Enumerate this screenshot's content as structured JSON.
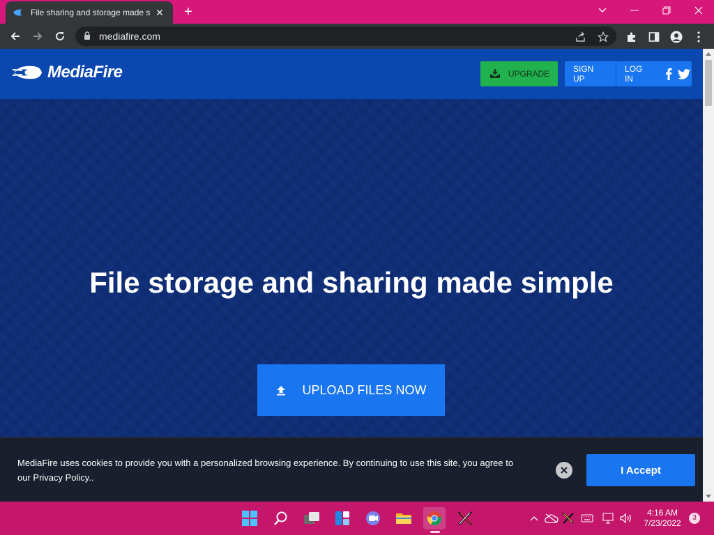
{
  "browser": {
    "tab": {
      "title": "File sharing and storage made si",
      "close_glyph": "✕",
      "favicon": "mediafire-flame-icon"
    },
    "new_tab_glyph": "+",
    "url": "mediafire.com"
  },
  "header": {
    "logo_text": "MediaFire",
    "upgrade_label": "UPGRADE",
    "signup_label": "SIGN UP",
    "login_label": "LOG IN"
  },
  "hero": {
    "title": "File storage and sharing made simple",
    "upload_label": "UPLOAD FILES NOW"
  },
  "cookie": {
    "text": "MediaFire uses cookies to provide you with a personalized browsing experience. By continuing to use this site, you agree to our Privacy Policy..",
    "accept_label": "I Accept"
  },
  "taskbar": {
    "time": "4:16 AM",
    "date": "7/23/2022",
    "notification_count": "3"
  },
  "colors": {
    "tabstrip": "#d7177a",
    "header": "#0a48b0",
    "hero": "#0f2e78",
    "primary_button": "#1a75f0",
    "upgrade_button": "#21b14e",
    "taskbar": "#c4176c"
  }
}
